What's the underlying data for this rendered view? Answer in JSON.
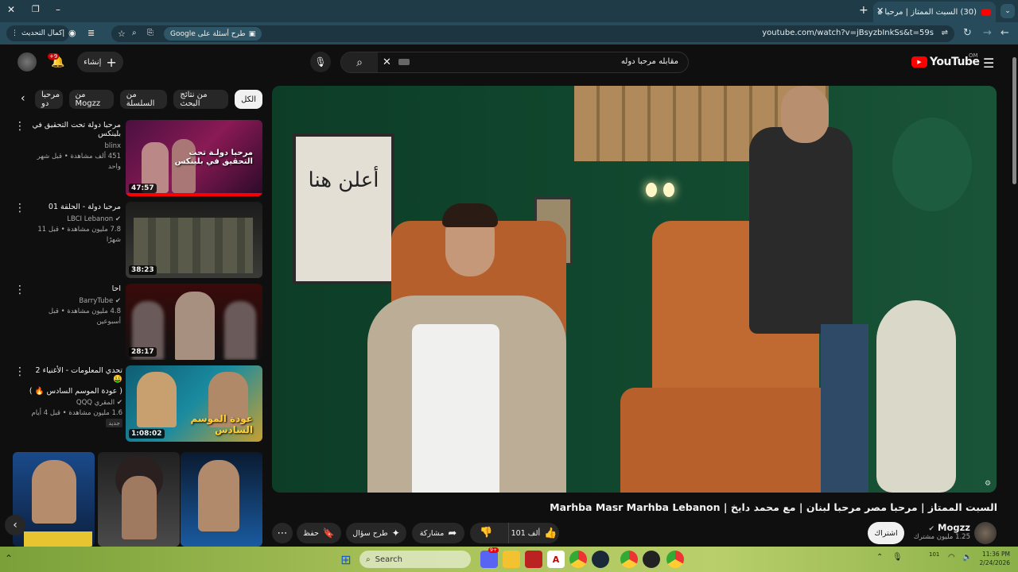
{
  "browser": {
    "tab_title": "(30) السبت الممتاز | مرحبا مصر م",
    "url": "youtube.com/watch?v=jBsyzbInkSs&t=59s",
    "ask_google": "طرح أسئلة على Google",
    "update_label": "إكمال التحديث"
  },
  "header": {
    "logo_text": "YouTube",
    "region": "OM",
    "search_value": "مقابله مرحبا دوله",
    "create_label": "إنشاء",
    "notif_count": "+9"
  },
  "chips": [
    "الكل",
    "من نتائج البحث",
    "من السلسلة",
    "من Mogzz",
    "مرحبا دو"
  ],
  "recommendations": [
    {
      "title": "مرحبا دولة تحت التحقيق في بلينكس",
      "channel": "blinx",
      "meta": "451 ألف مشاهدة • قبل شهر واحد",
      "duration": "47:57"
    },
    {
      "title": "مرحبا دولة - الحلقة 01",
      "channel": "LBCI Lebanon",
      "meta": "7.8 مليون مشاهدة • قبل 11 شهرًا",
      "duration": "38:23"
    },
    {
      "title": "احا",
      "channel": "BarryTube",
      "meta": "4.8 مليون مشاهدة • قبل أسبوعين",
      "duration": "28:17"
    },
    {
      "title": "تحدي المعلومات - الأغنياء 2 🤑",
      "title2": "( عودة الموسم السادس 🔥 )",
      "channel": "المقري QQQ",
      "meta": "1.6 مليون مشاهدة • قبل 4 أيام",
      "badge": "جديد",
      "duration": "1:08:02"
    }
  ],
  "video": {
    "title": "السبت الممتاز | مرحبا مصر مرحبا لبنان | مع محمد دايخ | Marhba Masr Marhba Lebanon",
    "wall_text": "أعلن هنا",
    "channel": "Mogzz",
    "subscribers": "1.25 مليون مشترك",
    "subscribe_label": "اشتراك",
    "likes": "101 ألف",
    "share_label": "مشاركة",
    "ask_label": "طرح سؤال",
    "save_label": "حفظ"
  },
  "thumb_overlay": {
    "title": "مرحبا دولـة تحت التحقيق في بلينكس",
    "season_title": "عودة الموسم السادس"
  },
  "taskbar": {
    "search_placeholder": "Search",
    "time": "11:36 PM",
    "date": "2/24/2026",
    "notif_badge": "9+",
    "battery": "101"
  }
}
